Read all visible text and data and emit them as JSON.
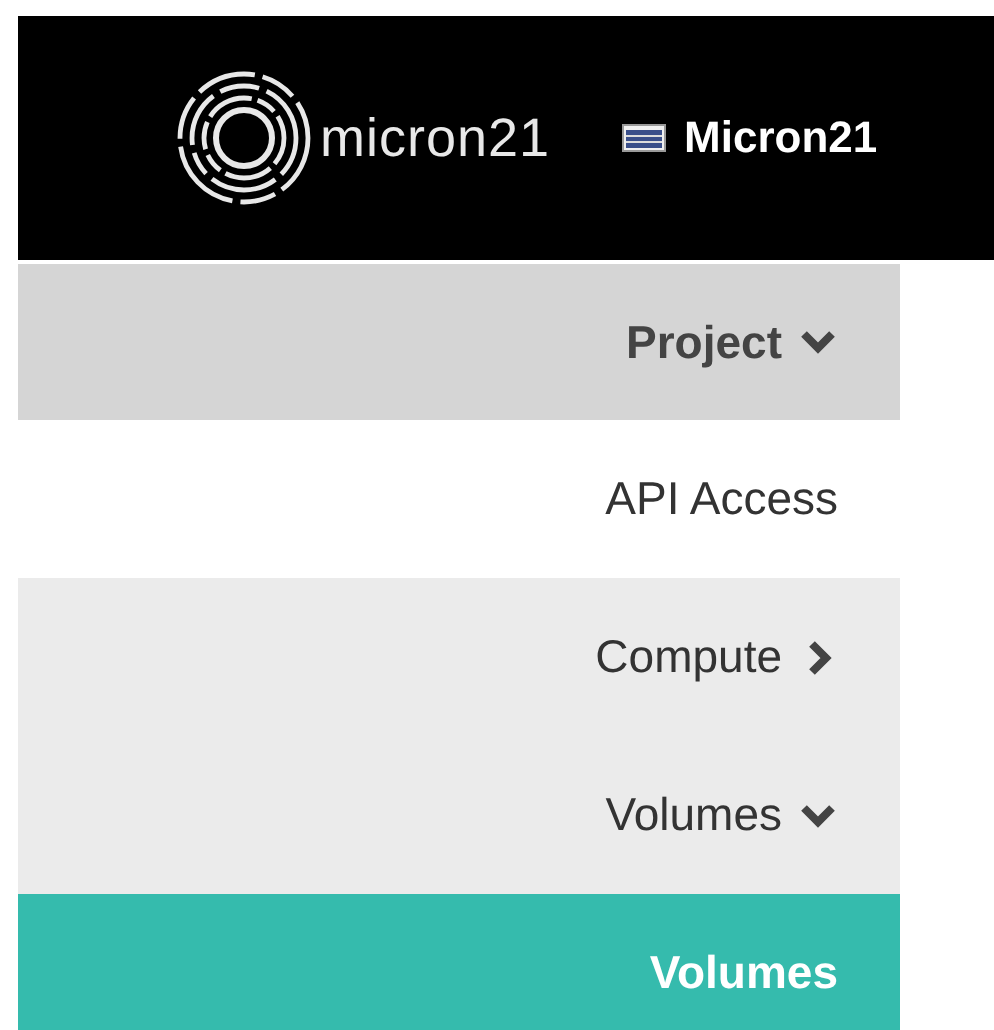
{
  "header": {
    "logo_text": "micron21",
    "project_label": "Micron21"
  },
  "sidebar": {
    "items": [
      {
        "kind": "section",
        "label": "Project",
        "expanded": true
      },
      {
        "kind": "link",
        "label": "API Access",
        "selected": false
      },
      {
        "kind": "group",
        "label": "Compute",
        "expanded": false
      },
      {
        "kind": "group",
        "label": "Volumes",
        "expanded": true
      },
      {
        "kind": "link",
        "label": "Volumes",
        "selected": true
      }
    ]
  }
}
